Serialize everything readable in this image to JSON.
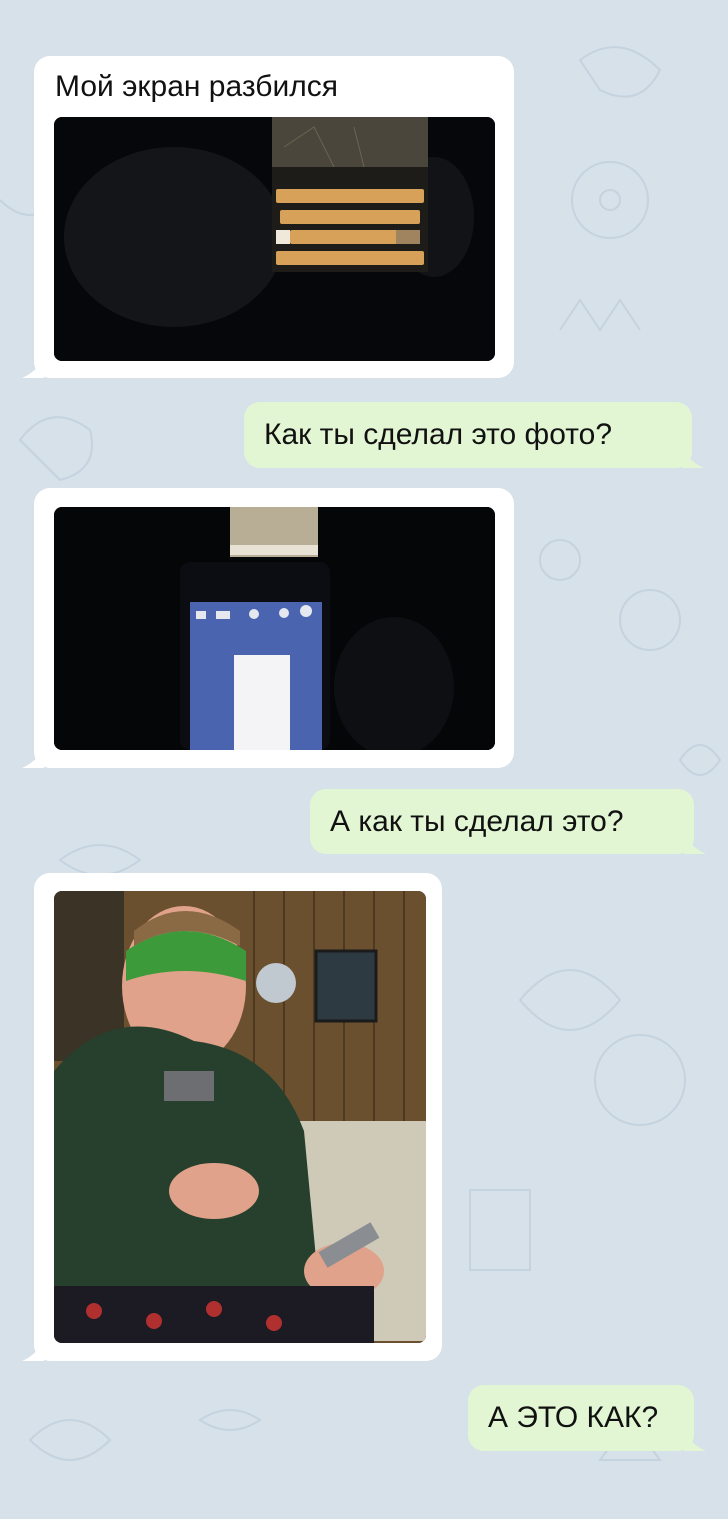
{
  "chat": {
    "messages": [
      {
        "side": "in",
        "text": "Мой экран разбился",
        "photo": "photo-broken-screen"
      },
      {
        "side": "out",
        "text": "Как ты сделал это фото?"
      },
      {
        "side": "in",
        "text": "",
        "photo": "photo-phone-holding-phone"
      },
      {
        "side": "out",
        "text": "А как ты сделал это?"
      },
      {
        "side": "in",
        "text": "",
        "photo": "photo-boy-with-phones"
      },
      {
        "side": "out",
        "text": "А ЭТО КАК?"
      }
    ]
  },
  "colors": {
    "background": "#d6e1ea",
    "incoming_bubble": "#ffffff",
    "outgoing_bubble": "#e3f6d4"
  }
}
